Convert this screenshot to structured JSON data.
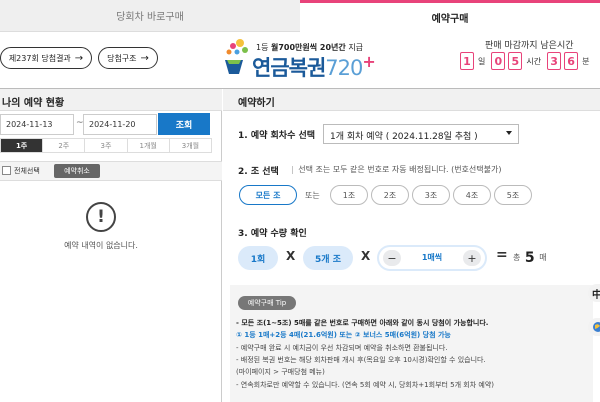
{
  "tabs": [
    {
      "label": "당회차 바로구매",
      "active": false
    },
    {
      "label": "예약구매",
      "active": true
    }
  ],
  "header": {
    "result_button": "제237회 당첨결과",
    "structure_button": "당첨구조",
    "logo_tagline_pre": "1등 ",
    "logo_tagline_bold": "월700만원씩 20년간",
    "logo_tagline_post": " 지급",
    "logo_brand": "연금복권",
    "logo_number": "720",
    "logo_plus": "+",
    "deadline_label": "판매 마감까지 남은시간",
    "deadline": [
      {
        "digits": [
          "1"
        ],
        "unit": "일"
      },
      {
        "digits": [
          "0",
          "5"
        ],
        "unit": "시간"
      },
      {
        "digits": [
          "3",
          "6"
        ],
        "unit": "분"
      }
    ]
  },
  "history": {
    "title": "나의 예약 현황",
    "date_from": "2024-11-13",
    "tilde": "~",
    "date_to": "2024-11-20",
    "search_label": "조회",
    "periods": [
      "1주",
      "2주",
      "3주",
      "1개월",
      "3개월"
    ],
    "active_period": 0,
    "select_all_label": "전체선택",
    "cancel_label": "예약취소",
    "empty_icon": "!",
    "empty_text": "예약 내역이 없습니다."
  },
  "reserve": {
    "title": "예약하기",
    "step1_label": "1. 예약 회차수 선택",
    "step1_value": "1개 회차 예약 ( 2024.11.28일 추첨 )",
    "step2_label": "2. 조 선택",
    "step2_sep": "|",
    "step2_desc": "선택 조는 모두 같은 번호로 자동 배정됩니다. (번호선택불가)",
    "all_groups_label": "모든 조",
    "or_label": "또는",
    "groups": [
      "1조",
      "2조",
      "3조",
      "4조",
      "5조"
    ],
    "step3_label": "3. 예약 수량 확인",
    "qty_rounds": "1회",
    "qty_groups": "5개 조",
    "multiply": "X",
    "minus": "−",
    "plus": "+",
    "qty_sheets": "1매씩",
    "equals": "=",
    "total_prefix": "총",
    "total_value": "5",
    "total_suffix": "매"
  },
  "tip": {
    "badge": "예약구매 Tip",
    "line1": "- 모든 조(1~5조) 5매를 같은 번호로 구매하면 아래와 같이 동시 당첨이 가능합니다.",
    "line2_pre": " ① 1등 1매+2등 4매(21.6억원) 또는 ② 보너스 5매(6억원) 당첨 가능",
    "line3": "- 예약구매 완료 시 예치금이 우선 차감되며 예약을 취소하면 환불됩니다.",
    "line4": "- 배정된 복권 번호는 해당 회차판매 개시 후(목요일 오후 10시경)확인할 수 있습니다.",
    "line5": "  (마이페이지 > 구매당첨 메뉴)",
    "line6": "- 연속회차로만 예약할 수 있습니다. (연속 5회 예약 시, 당회차+1회부터 5개 회차 예약)"
  },
  "floating": {
    "top_label": "中",
    "colors": {
      "accent": "#e8437a",
      "primary": "#1878c8",
      "brand": "#1b5a9a"
    }
  }
}
